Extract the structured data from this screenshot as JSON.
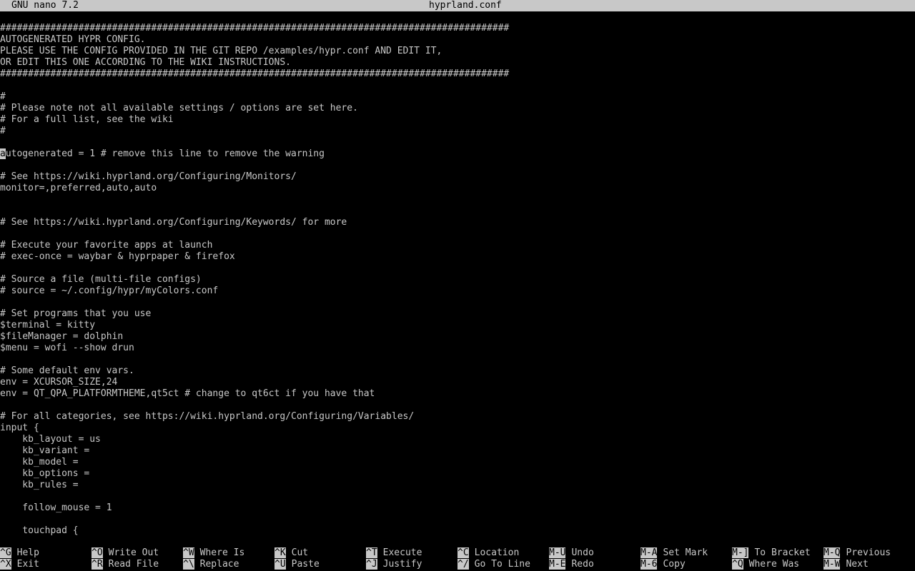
{
  "titlebar": {
    "version": "GNU nano 7.2",
    "filename": "hyprland.conf"
  },
  "editor": {
    "lines": [
      "###########################################################################################",
      "AUTOGENERATED HYPR CONFIG.",
      "PLEASE USE THE CONFIG PROVIDED IN THE GIT REPO /examples/hypr.conf AND EDIT IT,",
      "OR EDIT THIS ONE ACCORDING TO THE WIKI INSTRUCTIONS.",
      "###########################################################################################",
      "",
      "#",
      "# Please note not all available settings / options are set here.",
      "# For a full list, see the wiki",
      "#",
      "",
      "autogenerated = 1 # remove this line to remove the warning",
      "",
      "# See https://wiki.hyprland.org/Configuring/Monitors/",
      "monitor=,preferred,auto,auto",
      "",
      "",
      "# See https://wiki.hyprland.org/Configuring/Keywords/ for more",
      "",
      "# Execute your favorite apps at launch",
      "# exec-once = waybar & hyprpaper & firefox",
      "",
      "# Source a file (multi-file configs)",
      "# source = ~/.config/hypr/myColors.conf",
      "",
      "# Set programs that you use",
      "$terminal = kitty",
      "$fileManager = dolphin",
      "$menu = wofi --show drun",
      "",
      "# Some default env vars.",
      "env = XCURSOR_SIZE,24",
      "env = QT_QPA_PLATFORMTHEME,qt5ct # change to qt6ct if you have that",
      "",
      "# For all categories, see https://wiki.hyprland.org/Configuring/Variables/",
      "input {",
      "    kb_layout = us",
      "    kb_variant =",
      "    kb_model =",
      "    kb_options =",
      "    kb_rules =",
      "",
      "    follow_mouse = 1",
      "",
      "    touchpad {"
    ]
  },
  "shortcuts": {
    "row1": [
      {
        "key": "^G",
        "label": "Help"
      },
      {
        "key": "^O",
        "label": "Write Out"
      },
      {
        "key": "^W",
        "label": "Where Is"
      },
      {
        "key": "^K",
        "label": "Cut"
      },
      {
        "key": "^T",
        "label": "Execute"
      },
      {
        "key": "^C",
        "label": "Location"
      },
      {
        "key": "M-U",
        "label": "Undo"
      },
      {
        "key": "M-A",
        "label": "Set Mark"
      },
      {
        "key": "M-]",
        "label": "To Bracket"
      },
      {
        "key": "M-Q",
        "label": "Previous"
      }
    ],
    "row2": [
      {
        "key": "^X",
        "label": "Exit"
      },
      {
        "key": "^R",
        "label": "Read File"
      },
      {
        "key": "^\\",
        "label": "Replace"
      },
      {
        "key": "^U",
        "label": "Paste"
      },
      {
        "key": "^J",
        "label": "Justify"
      },
      {
        "key": "^/",
        "label": "Go To Line"
      },
      {
        "key": "M-E",
        "label": "Redo"
      },
      {
        "key": "M-6",
        "label": "Copy"
      },
      {
        "key": "^Q",
        "label": "Where Was"
      },
      {
        "key": "M-W",
        "label": "Next"
      }
    ]
  },
  "colors": {
    "background": "#000000",
    "foreground": "#c8c8c8",
    "inverse_bg": "#c8c8c8",
    "inverse_fg": "#000000"
  }
}
